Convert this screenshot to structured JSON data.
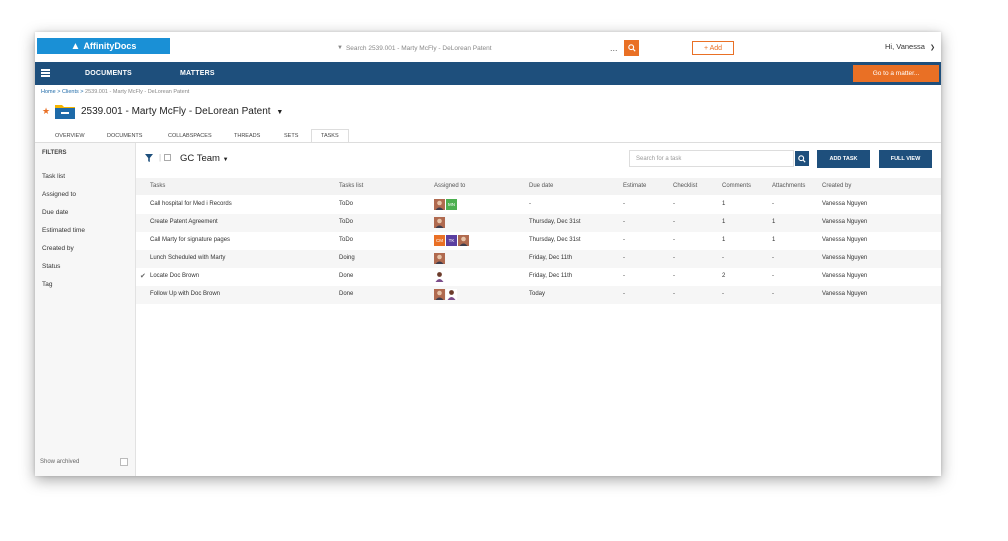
{
  "app": {
    "logo": "AffinityDocs"
  },
  "topbar": {
    "search_text": "Search 2539.001 - Marty McFly - DeLorean Patent",
    "search_more": "...",
    "add_label": "+ Add",
    "user_label": "Hi, Vanessa"
  },
  "nav": {
    "documents": "DOCUMENTS",
    "matters": "MATTERS",
    "goto_label": "Go to a matter..."
  },
  "header": {
    "breadcrumb": [
      "Home",
      "Clients",
      "2539.001 - Marty McFly - DeLorean Patent"
    ],
    "title": "2539.001 - Marty McFly - DeLorean Patent"
  },
  "tabs": [
    "OVERVIEW",
    "DOCUMENTS",
    "COLLABSPACES",
    "THREADS",
    "SETS",
    "TASKS"
  ],
  "active_tab": "TASKS",
  "sidebar": {
    "heading": "FILTERS",
    "items": [
      "Task list",
      "Assigned to",
      "Due date",
      "Estimated time",
      "Created by",
      "Status",
      "Tag"
    ],
    "show_archived": "Show archived"
  },
  "toolbar": {
    "team": "GC Team",
    "search_placeholder": "Search for a task",
    "add_task": "ADD TASK",
    "full_view": "FULL VIEW"
  },
  "table": {
    "columns": [
      "Tasks",
      "Tasks list",
      "Assigned to",
      "Due date",
      "Estimate",
      "Checklist",
      "Comments",
      "Attachments",
      "Created by"
    ],
    "rows": [
      {
        "task": "Call hospital for Med i Records",
        "list": "ToDo",
        "assignees": [
          "photo",
          "MN"
        ],
        "due": "-",
        "estimate": "-",
        "checklist": "-",
        "comments": "1",
        "attachments": "-",
        "created_by": "Vanessa Nguyen",
        "done": false
      },
      {
        "task": "Create Patent Agreement",
        "list": "ToDo",
        "assignees": [
          "photo"
        ],
        "due": "Thursday, Dec 31st",
        "estimate": "-",
        "checklist": "-",
        "comments": "1",
        "attachments": "1",
        "created_by": "Vanessa Nguyen",
        "done": false
      },
      {
        "task": "Call Marty for signature pages",
        "list": "ToDo",
        "assignees": [
          "CM",
          "TK",
          "photo"
        ],
        "due": "Thursday, Dec 31st",
        "estimate": "-",
        "checklist": "-",
        "comments": "1",
        "attachments": "1",
        "created_by": "Vanessa Nguyen",
        "done": false
      },
      {
        "task": "Lunch Scheduled with Marty",
        "list": "Doing",
        "assignees": [
          "photo"
        ],
        "due": "Friday, Dec 11th",
        "estimate": "-",
        "checklist": "-",
        "comments": "-",
        "attachments": "-",
        "created_by": "Vanessa Nguyen",
        "done": false
      },
      {
        "task": "Locate Doc Brown",
        "list": "Done",
        "assignees": [
          "photo-f"
        ],
        "due": "Friday, Dec 11th",
        "estimate": "-",
        "checklist": "-",
        "comments": "2",
        "attachments": "-",
        "created_by": "Vanessa Nguyen",
        "done": true
      },
      {
        "task": "Follow Up with Doc Brown",
        "list": "Done",
        "assignees": [
          "photo",
          "photo-f"
        ],
        "due": "Today",
        "estimate": "-",
        "checklist": "-",
        "comments": "-",
        "attachments": "-",
        "created_by": "Vanessa Nguyen",
        "done": false
      }
    ]
  },
  "colors": {
    "nav": "#1e4f7c",
    "accent": "#e97025",
    "logo": "#1a90d6",
    "avatar_mn": "#4caf50",
    "avatar_cm": "#e97025",
    "avatar_tk": "#5b3fa0"
  }
}
